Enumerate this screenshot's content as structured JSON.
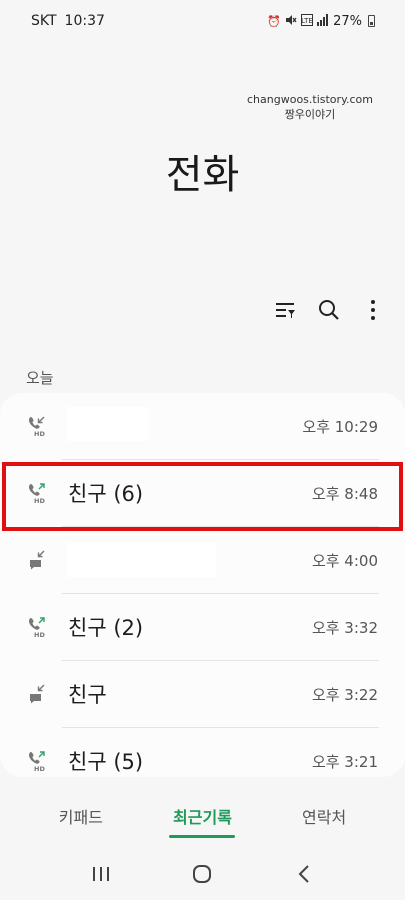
{
  "status_bar": {
    "carrier": "SKT",
    "time": "10:37",
    "battery": "27%",
    "icons": [
      "alarm-icon",
      "mute-icon",
      "lte-icon",
      "signal-icon",
      "battery-icon"
    ]
  },
  "watermark": {
    "line1": "changwoos.tistory.com",
    "line2": "짱우이야기"
  },
  "header": {
    "title": "전화"
  },
  "toolbar": {
    "icons": [
      "filter-icon",
      "search-icon",
      "more-icon"
    ]
  },
  "section": {
    "label": "오늘"
  },
  "calls": [
    {
      "name": "",
      "time": "오후 10:29",
      "type": "incoming-hd",
      "icon": "phone-incoming-hd-icon"
    },
    {
      "name": "친구 (6)",
      "time": "오후 8:48",
      "type": "outgoing-hd",
      "icon": "phone-outgoing-hd-icon"
    },
    {
      "name": "",
      "time": "오후 4:00",
      "type": "incoming-message",
      "icon": "message-incoming-icon"
    },
    {
      "name": "친구 (2)",
      "time": "오후 3:32",
      "type": "outgoing-hd",
      "icon": "phone-outgoing-hd-icon"
    },
    {
      "name": "친구",
      "time": "오후 3:22",
      "type": "incoming-message",
      "icon": "message-incoming-icon"
    },
    {
      "name": "친구 (5)",
      "time": "오후 3:21",
      "type": "outgoing-hd",
      "icon": "phone-outgoing-hd-icon"
    }
  ],
  "tabs": [
    {
      "label": "키패드",
      "active": false
    },
    {
      "label": "최근기록",
      "active": true
    },
    {
      "label": "연락처",
      "active": false
    }
  ],
  "colors": {
    "accent": "#1f9a5a",
    "highlight": "#e01010",
    "background": "#f6f6f6"
  },
  "nav": {
    "icons": [
      "recent-apps-icon",
      "home-icon",
      "back-icon"
    ]
  }
}
